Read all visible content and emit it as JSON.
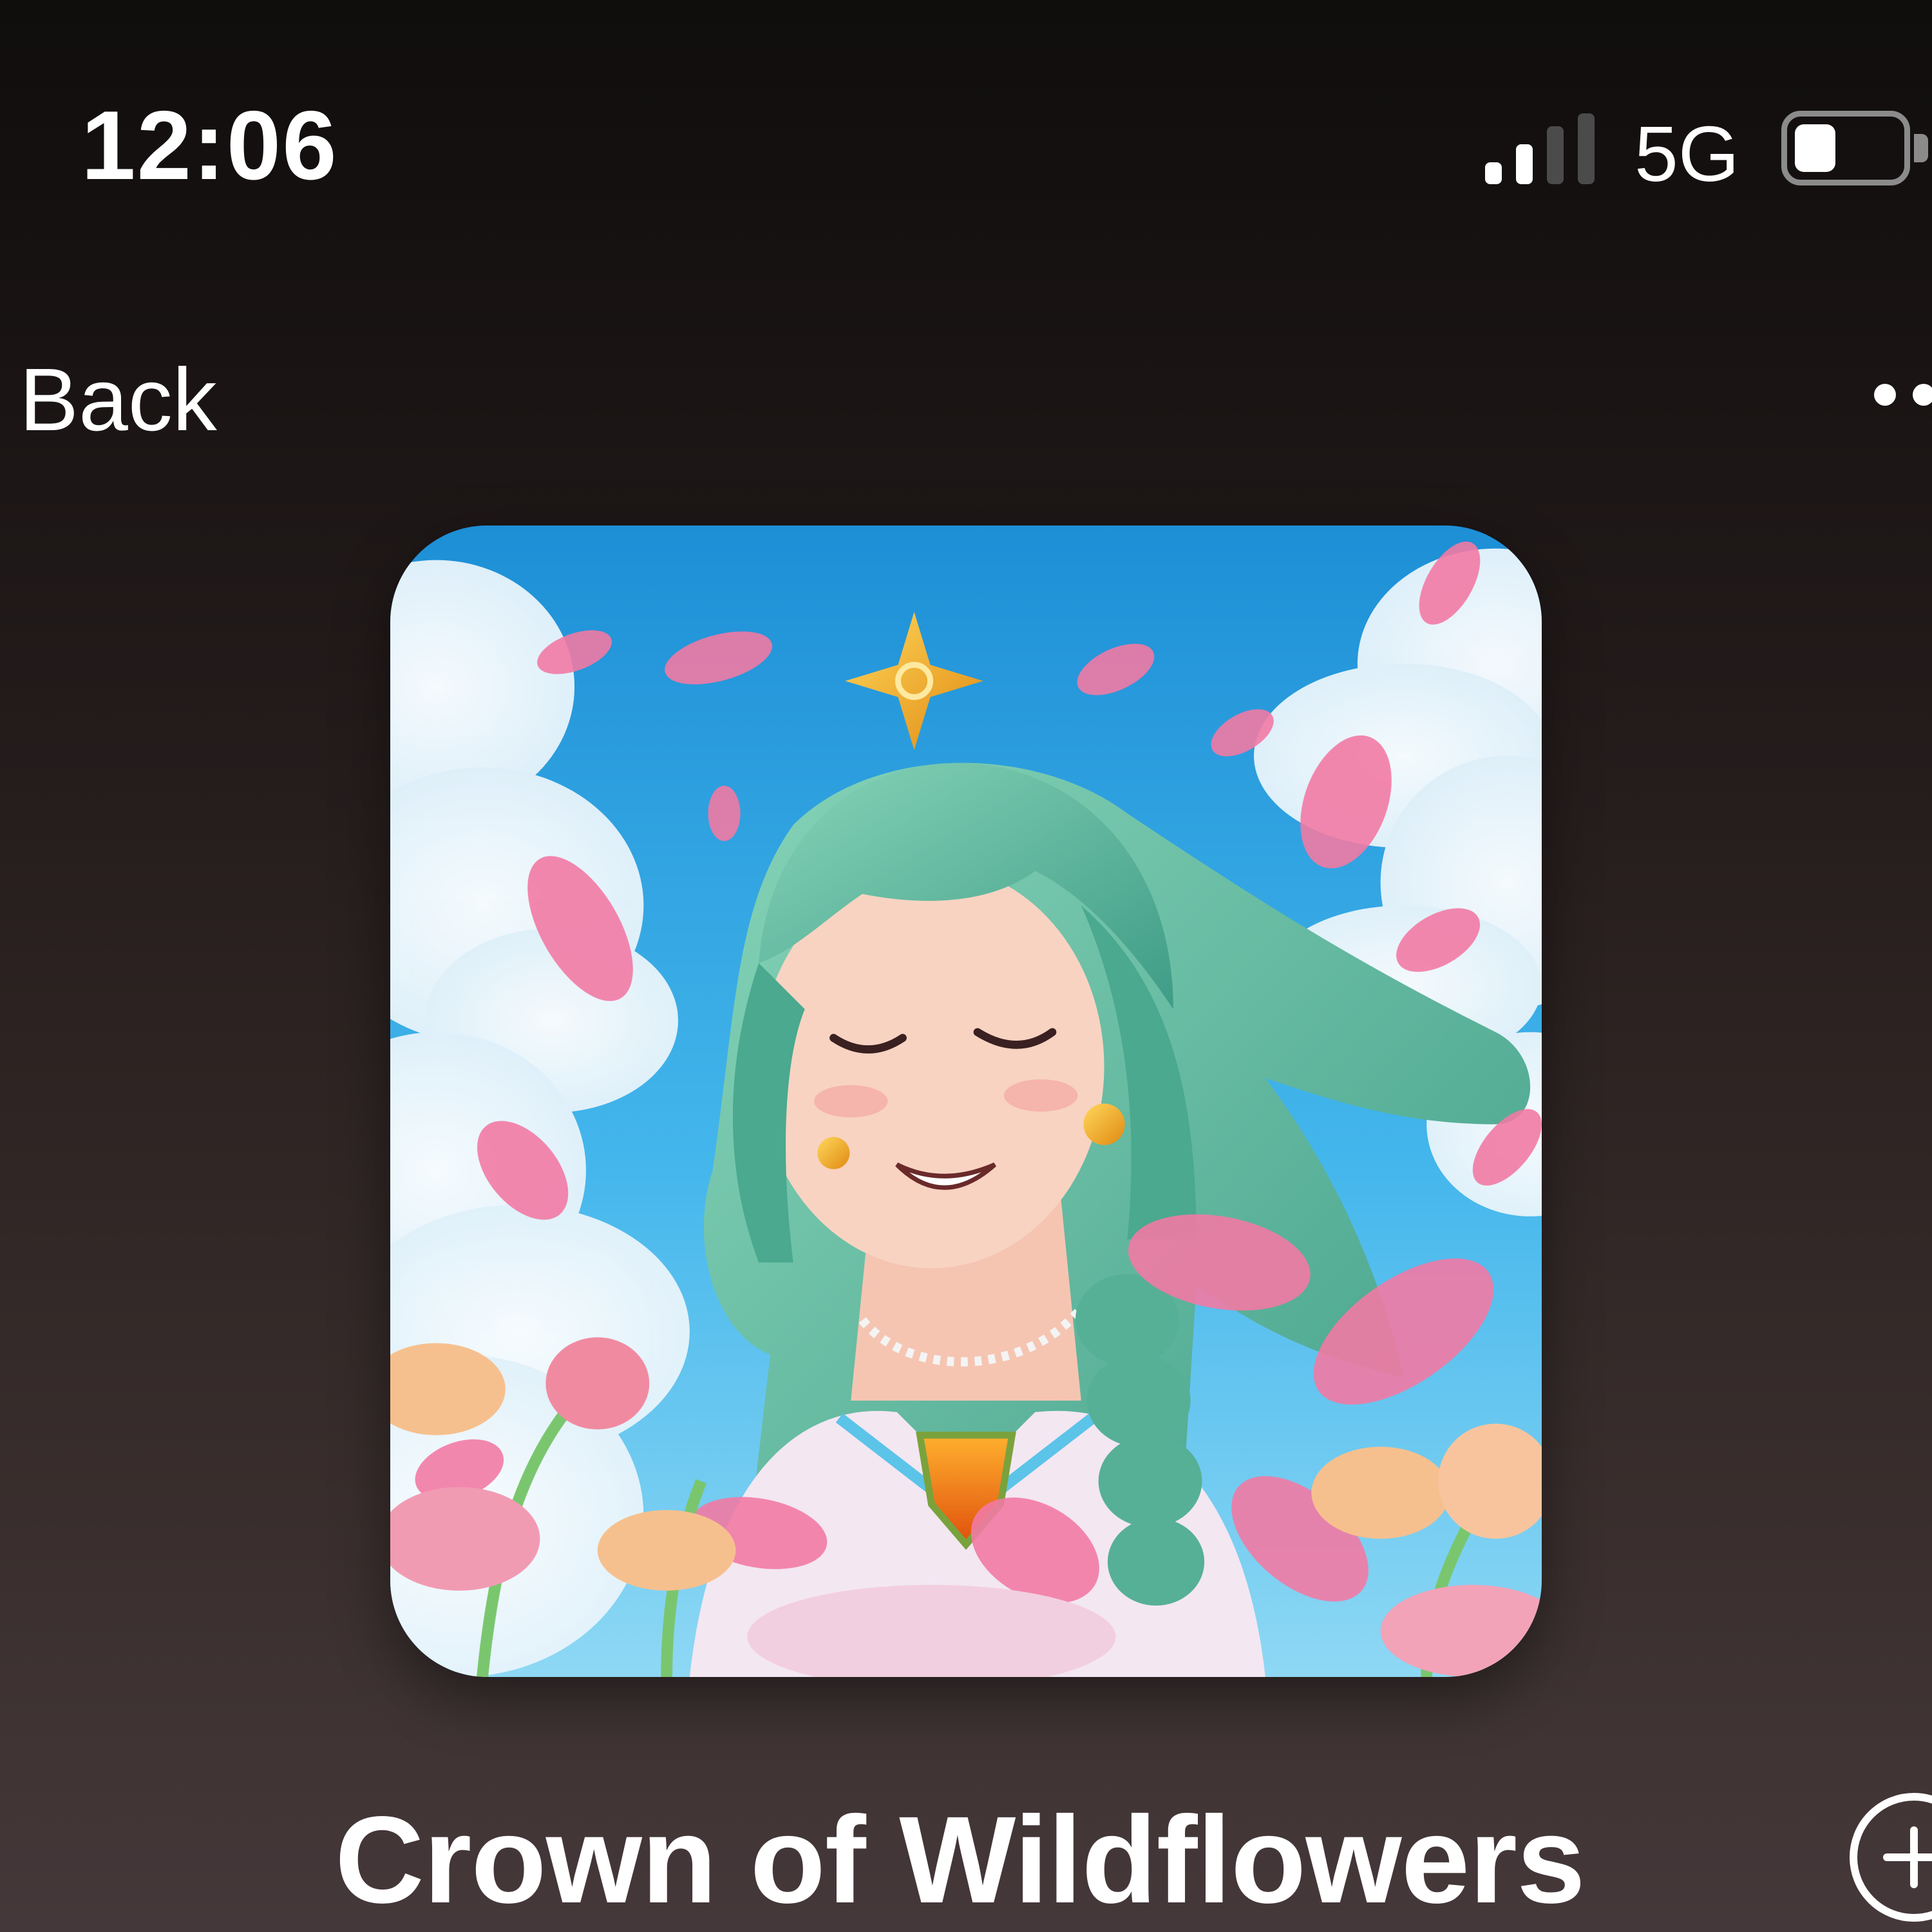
{
  "status_bar": {
    "time": "12:06",
    "network": "5G",
    "signal_bars_active": 2,
    "signal_bars_total": 4,
    "battery_level": 0.4
  },
  "nav": {
    "back_label": "Back",
    "more_icon": "ellipsis-icon"
  },
  "track": {
    "title": "Crown of Wildflowers",
    "add_icon": "add-circle-icon"
  },
  "colors": {
    "background_top": "#100d0d",
    "background_bottom": "#45383a",
    "text": "#ffffff",
    "signal_inactive": "#4b4b4b"
  }
}
